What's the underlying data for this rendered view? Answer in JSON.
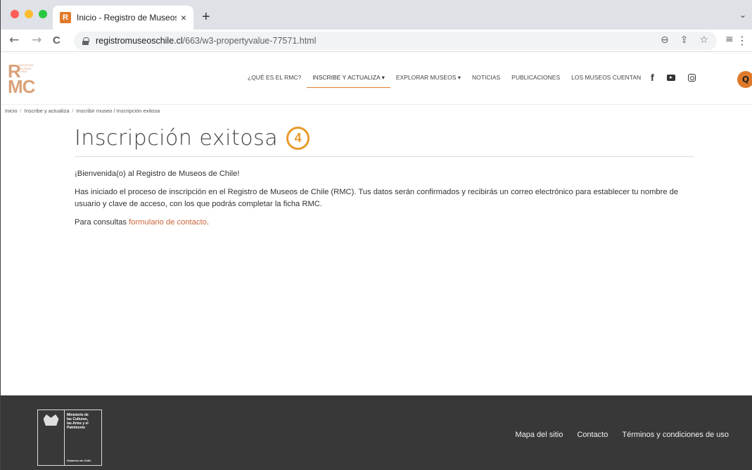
{
  "browser": {
    "tab_title": "Inicio - Registro de Museos de",
    "favicon_letter": "R",
    "tab_close": "×",
    "new_tab": "+",
    "url_domain": "registromuseoschile.cl",
    "url_path": "/663/w3-propertyvalue-77571.html",
    "back": "←",
    "forward": "→",
    "reload": "C",
    "colors": {
      "close": "#ff5f57",
      "minimize": "#febc2e",
      "maximize": "#28c840"
    }
  },
  "site": {
    "logo": {
      "letters_top": "R",
      "letters_bottom": "MC",
      "small_text": [
        "REGISTRO",
        "MUSEOS",
        "CHILE"
      ]
    },
    "nav": [
      {
        "label": "¿QUÉ ES EL RMC?"
      },
      {
        "label": "INSCRIBE Y ACTUALIZA ▾"
      },
      {
        "label": "EXPLORAR MUSEOS ▾"
      },
      {
        "label": "NOTICIAS"
      },
      {
        "label": "PUBLICACIONES"
      },
      {
        "label": "LOS MUSEOS CUENTAN"
      }
    ],
    "facebook": "f",
    "search": "Q",
    "accent_color": "#e07a2b"
  },
  "breadcrumb": [
    "Inicio",
    "Inscribe y actualiza",
    "Inscribir museo / Inscripción exitosa"
  ],
  "breadcrumb_sep": "/",
  "page": {
    "title": "Inscripción exitosa",
    "step": "4",
    "welcome": "¡Bienvenida(o) al Registro de Museos de Chile!",
    "body": "Has iniciado el proceso de inscripción en el Registro de Museos de Chile (RMC). Tus datos serán confirmados y recibirás un correo electrónico para establecer tu nombre de usuario y clave de acceso, con los que podrás completar la ficha RMC.",
    "contact_prefix": "Para consultas ",
    "contact_link": "formulario de contacto",
    "contact_suffix": "."
  },
  "footer": {
    "ministry_lines": [
      "Ministerio de",
      "las Culturas,",
      "las Artes y el",
      "Patrimonio"
    ],
    "gobierno": "Gobierno de Chile",
    "links": [
      "Mapa del sitio",
      "Contacto",
      "Términos y condiciones de uso"
    ]
  }
}
